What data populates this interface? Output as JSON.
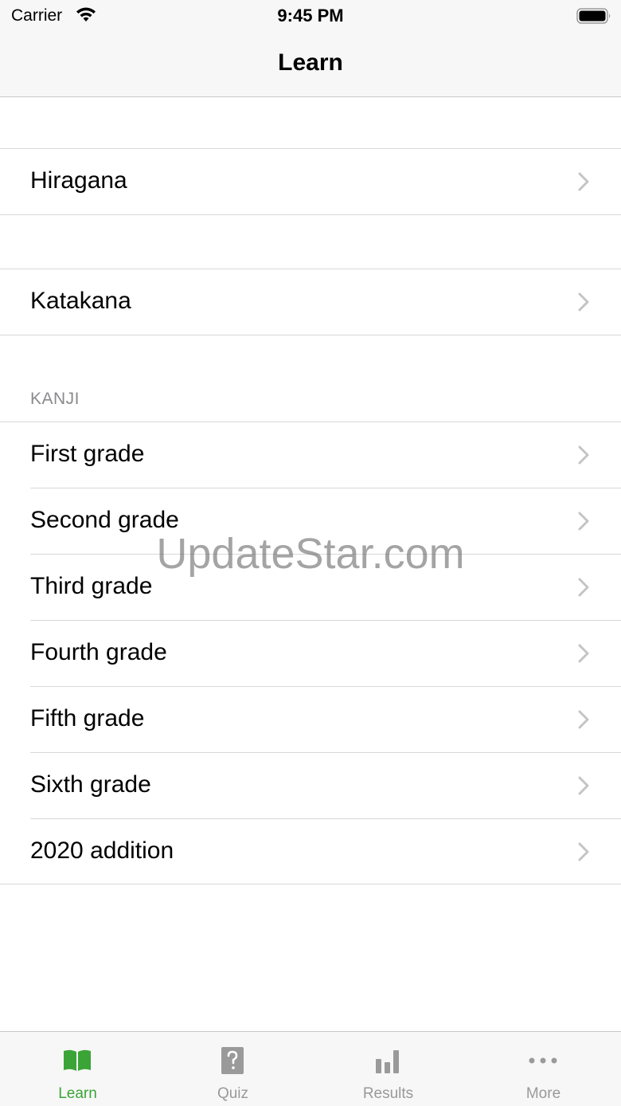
{
  "status_bar": {
    "carrier": "Carrier",
    "time": "9:45 PM"
  },
  "nav": {
    "title": "Learn"
  },
  "sections": {
    "hiragana": "Hiragana",
    "katakana": "Katakana",
    "kanji_header": "KANJI",
    "kanji_items": [
      "First grade",
      "Second grade",
      "Third grade",
      "Fourth grade",
      "Fifth grade",
      "Sixth grade",
      "2020 addition"
    ]
  },
  "watermark": "UpdateStar.com",
  "tabs": [
    {
      "label": "Learn",
      "icon": "book-icon",
      "active": true
    },
    {
      "label": "Quiz",
      "icon": "question-icon",
      "active": false
    },
    {
      "label": "Results",
      "icon": "bar-chart-icon",
      "active": false
    },
    {
      "label": "More",
      "icon": "more-dots-icon",
      "active": false
    }
  ],
  "colors": {
    "accent": "#3aa536",
    "inactive": "#999999",
    "separator": "#d8d8dc",
    "chevron": "#c4c4c7"
  }
}
